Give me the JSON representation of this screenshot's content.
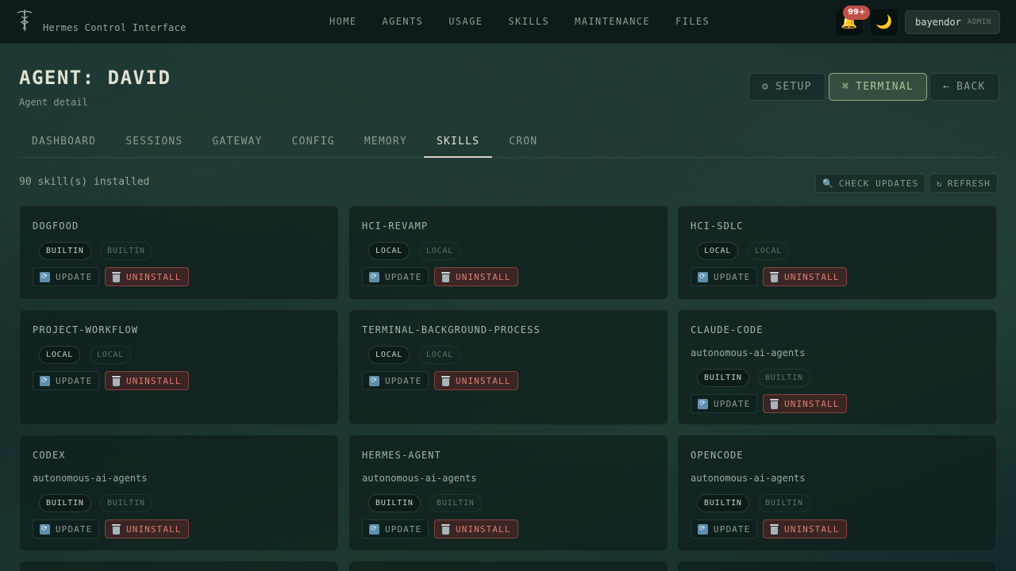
{
  "app": {
    "brand": "Hermes Control Interface",
    "notification_count": "99+",
    "user": "bayendor",
    "role": "ADMIN"
  },
  "nav": [
    "HOME",
    "AGENTS",
    "USAGE",
    "SKILLS",
    "MAINTENANCE",
    "FILES"
  ],
  "header": {
    "title": "AGENT: DAVID",
    "subtitle": "Agent detail",
    "setup": "SETUP",
    "terminal": "TERMINAL",
    "back": "BACK"
  },
  "tabs": [
    "DASHBOARD",
    "SESSIONS",
    "GATEWAY",
    "CONFIG",
    "MEMORY",
    "SKILLS",
    "CRON"
  ],
  "active_tab": "SKILLS",
  "skills": {
    "count_text": "90 skill(s) installed",
    "check_updates": "CHECK UPDATES",
    "refresh": "REFRESH",
    "update_label": "UPDATE",
    "uninstall_label": "UNINSTALL",
    "cards": [
      {
        "name": "DOGFOOD",
        "category": "",
        "source": "BUILTIN",
        "source2": "BUILTIN"
      },
      {
        "name": "HCI-REVAMP",
        "category": "",
        "source": "LOCAL",
        "source2": "LOCAL"
      },
      {
        "name": "HCI-SDLC",
        "category": "",
        "source": "LOCAL",
        "source2": "LOCAL"
      },
      {
        "name": "PROJECT-WORKFLOW",
        "category": "",
        "source": "LOCAL",
        "source2": "LOCAL"
      },
      {
        "name": "TERMINAL-BACKGROUND-PROCESS",
        "category": "",
        "source": "LOCAL",
        "source2": "LOCAL"
      },
      {
        "name": "CLAUDE-CODE",
        "category": "autonomous-ai-agents",
        "source": "BUILTIN",
        "source2": "BUILTIN"
      },
      {
        "name": "CODEX",
        "category": "autonomous-ai-agents",
        "source": "BUILTIN",
        "source2": "BUILTIN"
      },
      {
        "name": "HERMES-AGENT",
        "category": "autonomous-ai-agents",
        "source": "BUILTIN",
        "source2": "BUILTIN"
      },
      {
        "name": "OPENCODE",
        "category": "autonomous-ai-agents",
        "source": "BUILTIN",
        "source2": "BUILTIN"
      }
    ]
  }
}
